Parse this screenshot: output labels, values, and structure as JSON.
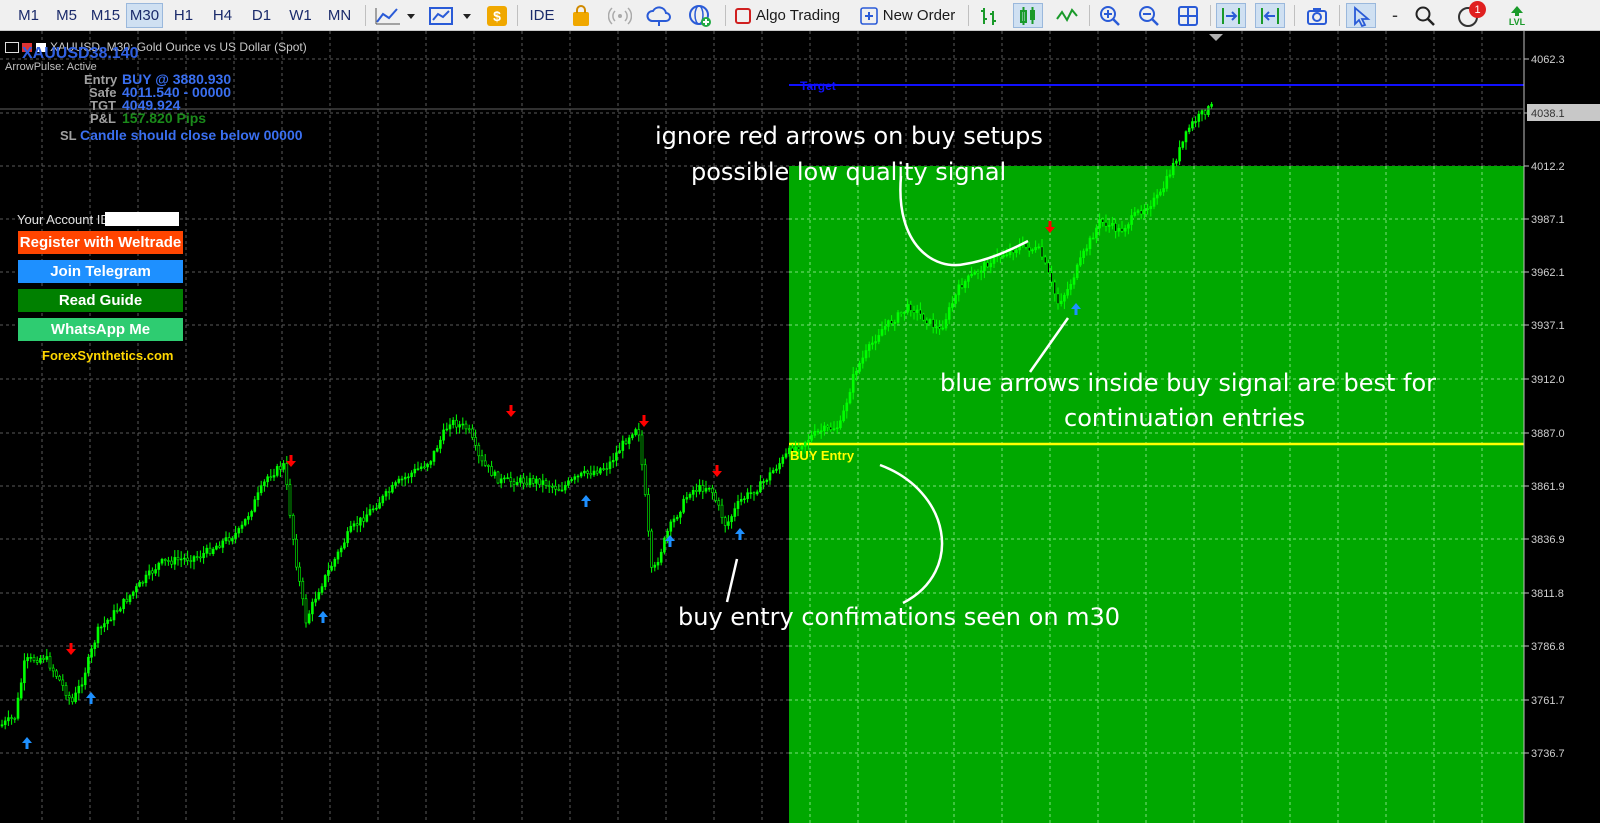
{
  "toolbar": {
    "timeframes": [
      "M1",
      "M5",
      "M15",
      "M30",
      "H1",
      "H4",
      "D1",
      "W1",
      "MN"
    ],
    "active_timeframe": "M30",
    "ide_label": "IDE",
    "algo_trading_label": "Algo Trading",
    "new_order_label": "New Order",
    "notification_count": "1",
    "lvl_label": "LVL"
  },
  "chart": {
    "symbol_title": "XAUUSD, M30:  Gold Ounce vs US Dollar (Spot)",
    "current_price_display": "XAUUSD38.140",
    "indicator_status": "ArrowPulse: Active",
    "price_axis_labels": [
      "4062.3",
      "4038.1",
      "4012.2",
      "3987.1",
      "3962.1",
      "3937.1",
      "3912.0",
      "3887.0",
      "3861.9",
      "3836.9",
      "3811.8",
      "3786.8",
      "3761.7",
      "3736.7"
    ],
    "highlighted_price": "4038.1",
    "target_line_label": "Target",
    "buy_entry_line_label": "BUY Entry"
  },
  "signal_panel": {
    "entry_label": "Entry",
    "entry_value": "BUY @ 3880.930",
    "safe_label": "Safe",
    "safe_value": "4011.540 - 00000",
    "tgt_label": "TGT",
    "tgt_value": "4049.924",
    "pl_label": "P&L",
    "pl_value": "157.820 Pips",
    "sl_label": "SL",
    "sl_value": "Candle should close below 00000"
  },
  "account": {
    "account_id_label": "Your Account ID",
    "register_button": "Register with Weltrade",
    "telegram_button": "Join Telegram",
    "guide_button": "Read Guide",
    "whatsapp_button": "WhatsApp Me",
    "website": "ForexSynthetics.com"
  },
  "annotations": {
    "ignore_red_line1": "ignore red arrows on buy setups",
    "ignore_red_line2": "possible low quality signal",
    "blue_arrows_line1": "blue arrows inside buy signal are best for",
    "blue_arrows_line2": "continuation entries",
    "buy_confirmations": "buy entry confimations seen on m30"
  },
  "colors": {
    "candle_green": "#00ff00",
    "buy_zone": "#00a800",
    "target_line": "#0000ff",
    "entry_line": "#ffff00",
    "buy_arrow": "#1e90ff",
    "sell_arrow": "#ff0000",
    "register_btn": "#ff4500",
    "telegram_btn": "#1e90ff",
    "guide_btn": "#008000",
    "whatsapp_btn": "#2ecc71",
    "website_text": "#ffd700"
  }
}
